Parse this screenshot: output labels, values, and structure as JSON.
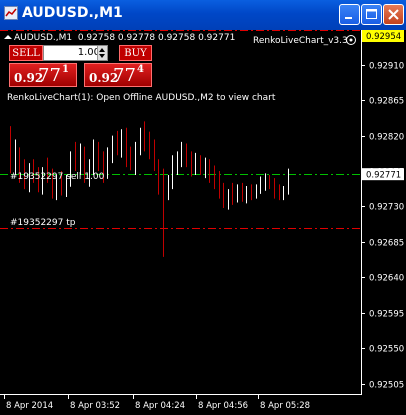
{
  "window": {
    "title": "AUDUSD.,M1"
  },
  "chart_header": {
    "symbol_line": "AUDUSD.,M1  0.92758 0.92778 0.92758 0.92771",
    "indicator_name": "RenkoLiveChart_v3.3",
    "notice": "RenkoLiveChart(1): Open Offline AUDUSD.,M2 to view chart"
  },
  "trade_panel": {
    "sell_label": "SELL",
    "buy_label": "BUY",
    "lot": "1.00",
    "sell_quote": {
      "prefix": "0.92",
      "big": "77",
      "sup": "1"
    },
    "buy_quote": {
      "prefix": "0.92",
      "big": "77",
      "sup": "4"
    }
  },
  "order_labels": {
    "sell": "#19352297 sell 1.00",
    "tp": "#19352297 tp"
  },
  "price_axis": {
    "ticks": [
      "0.92910",
      "0.92865",
      "0.92820",
      "0.92775",
      "0.92730",
      "0.92685",
      "0.92640",
      "0.92595",
      "0.92550",
      "0.92505"
    ],
    "current_price": "0.92771",
    "top_price": "0.92954"
  },
  "time_axis": {
    "ticks": [
      "8 Apr 2014",
      "8 Apr 03:52",
      "8 Apr 04:24",
      "8 Apr 04:56",
      "8 Apr 05:28"
    ]
  },
  "colors": {
    "up_candle": "#ffffff",
    "down_candle": "#c00000",
    "sell_line": "#00c000",
    "tp_line": "#e00000",
    "title_bar": "#0047c7"
  },
  "chart_data": {
    "type": "candlestick",
    "symbol": "AUDUSD.",
    "timeframe": "M1",
    "ylim": [
      0.92492,
      0.92954
    ],
    "y_ticks": [
      0.9291,
      0.92865,
      0.9282,
      0.92775,
      0.9273,
      0.92685,
      0.9264,
      0.92595,
      0.9255,
      0.92505
    ],
    "x_ticks": [
      "8 Apr 2014",
      "8 Apr 03:52",
      "8 Apr 04:24",
      "8 Apr 04:56",
      "8 Apr 05:28"
    ],
    "horizontal_lines": [
      {
        "label": "#19352297 sell 1.00",
        "price": 0.92771,
        "style": "dash-dot",
        "color": "#00c000"
      },
      {
        "label": "#19352297 tp",
        "price": 0.92703,
        "style": "dash-dot",
        "color": "#e00000"
      },
      {
        "price": 0.92954,
        "style": "dash-dot",
        "color": "#e00000"
      }
    ],
    "candles": [
      {
        "o": 0.9281,
        "h": 0.92832,
        "l": 0.92772,
        "c": 0.9279
      },
      {
        "o": 0.9279,
        "h": 0.92815,
        "l": 0.9277,
        "c": 0.928
      },
      {
        "o": 0.928,
        "h": 0.92805,
        "l": 0.9276,
        "c": 0.9277
      },
      {
        "o": 0.9277,
        "h": 0.9279,
        "l": 0.92752,
        "c": 0.9276
      },
      {
        "o": 0.9276,
        "h": 0.92785,
        "l": 0.92748,
        "c": 0.92775
      },
      {
        "o": 0.92775,
        "h": 0.9279,
        "l": 0.9276,
        "c": 0.92765
      },
      {
        "o": 0.92765,
        "h": 0.9278,
        "l": 0.92748,
        "c": 0.92755
      },
      {
        "o": 0.92755,
        "h": 0.9278,
        "l": 0.92745,
        "c": 0.9277
      },
      {
        "o": 0.9277,
        "h": 0.92792,
        "l": 0.9276,
        "c": 0.92765
      },
      {
        "o": 0.92765,
        "h": 0.92778,
        "l": 0.9274,
        "c": 0.92745
      },
      {
        "o": 0.92745,
        "h": 0.9277,
        "l": 0.92738,
        "c": 0.9276
      },
      {
        "o": 0.9276,
        "h": 0.92775,
        "l": 0.92744,
        "c": 0.9275
      },
      {
        "o": 0.9275,
        "h": 0.9277,
        "l": 0.92742,
        "c": 0.92765
      },
      {
        "o": 0.92765,
        "h": 0.928,
        "l": 0.92755,
        "c": 0.9279
      },
      {
        "o": 0.9279,
        "h": 0.92812,
        "l": 0.92775,
        "c": 0.9278
      },
      {
        "o": 0.9278,
        "h": 0.9281,
        "l": 0.9277,
        "c": 0.928
      },
      {
        "o": 0.928,
        "h": 0.92806,
        "l": 0.9276,
        "c": 0.9277
      },
      {
        "o": 0.9277,
        "h": 0.9279,
        "l": 0.92755,
        "c": 0.9278
      },
      {
        "o": 0.9278,
        "h": 0.92815,
        "l": 0.9277,
        "c": 0.92805
      },
      {
        "o": 0.92805,
        "h": 0.92812,
        "l": 0.92775,
        "c": 0.92785
      },
      {
        "o": 0.92785,
        "h": 0.928,
        "l": 0.9276,
        "c": 0.9277
      },
      {
        "o": 0.9277,
        "h": 0.92805,
        "l": 0.92765,
        "c": 0.92798
      },
      {
        "o": 0.92798,
        "h": 0.9282,
        "l": 0.92785,
        "c": 0.9281
      },
      {
        "o": 0.9281,
        "h": 0.92826,
        "l": 0.92795,
        "c": 0.928
      },
      {
        "o": 0.928,
        "h": 0.92828,
        "l": 0.92792,
        "c": 0.9282
      },
      {
        "o": 0.9282,
        "h": 0.9283,
        "l": 0.9278,
        "c": 0.9279
      },
      {
        "o": 0.9279,
        "h": 0.92806,
        "l": 0.92776,
        "c": 0.92782
      },
      {
        "o": 0.92782,
        "h": 0.92812,
        "l": 0.9277,
        "c": 0.92805
      },
      {
        "o": 0.92805,
        "h": 0.9283,
        "l": 0.92795,
        "c": 0.9282
      },
      {
        "o": 0.9282,
        "h": 0.92838,
        "l": 0.928,
        "c": 0.9281
      },
      {
        "o": 0.9281,
        "h": 0.92825,
        "l": 0.9279,
        "c": 0.92795
      },
      {
        "o": 0.92795,
        "h": 0.92815,
        "l": 0.92775,
        "c": 0.9278
      },
      {
        "o": 0.9278,
        "h": 0.9279,
        "l": 0.92745,
        "c": 0.9276
      },
      {
        "o": 0.9276,
        "h": 0.92778,
        "l": 0.92666,
        "c": 0.92748
      },
      {
        "o": 0.92748,
        "h": 0.9277,
        "l": 0.92738,
        "c": 0.92758
      },
      {
        "o": 0.92758,
        "h": 0.92795,
        "l": 0.92752,
        "c": 0.92785
      },
      {
        "o": 0.92785,
        "h": 0.928,
        "l": 0.9277,
        "c": 0.9279
      },
      {
        "o": 0.9279,
        "h": 0.92812,
        "l": 0.9278,
        "c": 0.92798
      },
      {
        "o": 0.92798,
        "h": 0.9281,
        "l": 0.9278,
        "c": 0.92786
      },
      {
        "o": 0.92786,
        "h": 0.928,
        "l": 0.92768,
        "c": 0.92775
      },
      {
        "o": 0.92775,
        "h": 0.92798,
        "l": 0.9277,
        "c": 0.9279
      },
      {
        "o": 0.9279,
        "h": 0.92795,
        "l": 0.9277,
        "c": 0.92778
      },
      {
        "o": 0.92778,
        "h": 0.92792,
        "l": 0.92766,
        "c": 0.92785
      },
      {
        "o": 0.92785,
        "h": 0.9279,
        "l": 0.9276,
        "c": 0.92768
      },
      {
        "o": 0.92768,
        "h": 0.92782,
        "l": 0.92752,
        "c": 0.9276
      },
      {
        "o": 0.9276,
        "h": 0.92775,
        "l": 0.9274,
        "c": 0.92748
      },
      {
        "o": 0.92748,
        "h": 0.9276,
        "l": 0.92728,
        "c": 0.92735
      },
      {
        "o": 0.92735,
        "h": 0.92752,
        "l": 0.92726,
        "c": 0.92745
      },
      {
        "o": 0.92745,
        "h": 0.9276,
        "l": 0.92732,
        "c": 0.9274
      },
      {
        "o": 0.9274,
        "h": 0.92758,
        "l": 0.92735,
        "c": 0.92752
      },
      {
        "o": 0.92752,
        "h": 0.9276,
        "l": 0.92736,
        "c": 0.92742
      },
      {
        "o": 0.92742,
        "h": 0.92756,
        "l": 0.92734,
        "c": 0.9275
      },
      {
        "o": 0.9275,
        "h": 0.92758,
        "l": 0.92738,
        "c": 0.92744
      },
      {
        "o": 0.92744,
        "h": 0.92758,
        "l": 0.9274,
        "c": 0.92752
      },
      {
        "o": 0.92752,
        "h": 0.92768,
        "l": 0.92746,
        "c": 0.9276
      },
      {
        "o": 0.9276,
        "h": 0.92772,
        "l": 0.9275,
        "c": 0.92765
      },
      {
        "o": 0.92765,
        "h": 0.9277,
        "l": 0.92752,
        "c": 0.92758
      },
      {
        "o": 0.92758,
        "h": 0.92766,
        "l": 0.9274,
        "c": 0.92748
      },
      {
        "o": 0.92748,
        "h": 0.92758,
        "l": 0.92738,
        "c": 0.92742
      },
      {
        "o": 0.92742,
        "h": 0.92756,
        "l": 0.92738,
        "c": 0.9275
      },
      {
        "o": 0.9275,
        "h": 0.92778,
        "l": 0.92745,
        "c": 0.92771
      }
    ]
  }
}
